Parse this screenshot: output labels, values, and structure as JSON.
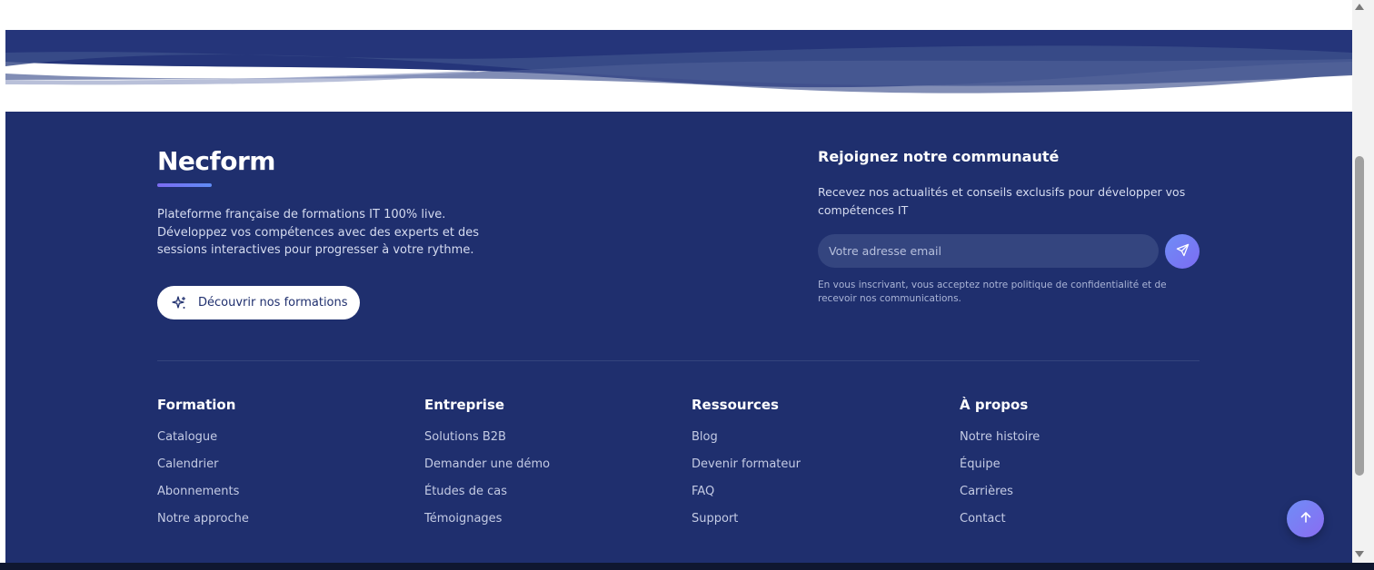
{
  "colors": {
    "footer_bg": "#1f2f6e",
    "accent_gradient_start": "#7c6cf2",
    "accent_gradient_end": "#5f8cf5",
    "text_muted": "#d6dcf0"
  },
  "brand": {
    "name": "Necform",
    "description": "Plateforme française de formations IT 100% live. Développez vos compétences avec des experts et des sessions interactives pour progresser à votre rythme.",
    "cta_label": "Découvrir nos formations",
    "cta_icon": "sparkles-icon"
  },
  "newsletter": {
    "title": "Rejoignez notre communauté",
    "description": "Recevez nos actualités et conseils exclusifs pour développer vos compétences IT",
    "email_placeholder": "Votre adresse email",
    "email_value": "",
    "send_icon": "send-icon",
    "legal": "En vous inscrivant, vous acceptez notre politique de confidentialité et de recevoir nos communications."
  },
  "columns": [
    {
      "title": "Formation",
      "links": [
        "Catalogue",
        "Calendrier",
        "Abonnements",
        "Notre approche"
      ]
    },
    {
      "title": "Entreprise",
      "links": [
        "Solutions B2B",
        "Demander une démo",
        "Études de cas",
        "Témoignages"
      ]
    },
    {
      "title": "Ressources",
      "links": [
        "Blog",
        "Devenir formateur",
        "FAQ",
        "Support"
      ]
    },
    {
      "title": "À propos",
      "links": [
        "Notre histoire",
        "Équipe",
        "Carrières",
        "Contact"
      ]
    }
  ],
  "scroll_top_icon": "arrow-up-icon"
}
